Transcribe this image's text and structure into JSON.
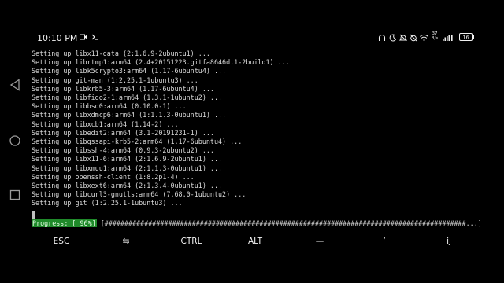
{
  "status_bar": {
    "time": "10:10 PM",
    "left_icons": [
      "video-icon",
      "terminal-prompt-icon"
    ],
    "right_icons": [
      "headphones-icon",
      "do-not-disturb-icon",
      "mute-icon",
      "alarm-off-icon",
      "wifi-icon",
      "network-speed-icon",
      "lte-signal-icon",
      "battery-icon"
    ],
    "network_speed": "37 B/s",
    "battery": "16"
  },
  "nav_bar": {
    "icons": [
      "back-icon",
      "home-icon",
      "recents-icon"
    ]
  },
  "terminal": {
    "lines": [
      "Setting up libx11-data (2:1.6.9-2ubuntu1) ...",
      "Setting up librtmp1:arm64 (2.4+20151223.gitfa8646d.1-2build1) ...",
      "Setting up libk5crypto3:arm64 (1.17-6ubuntu4) ...",
      "Setting up git-man (1:2.25.1-1ubuntu3) ...",
      "Setting up libkrb5-3:arm64 (1.17-6ubuntu4) ...",
      "Setting up libfido2-1:arm64 (1.3.1-1ubuntu2) ...",
      "Setting up libbsd0:arm64 (0.10.0-1) ...",
      "Setting up libxdmcp6:arm64 (1:1.1.3-0ubuntu1) ...",
      "Setting up libxcb1:arm64 (1.14-2) ...",
      "Setting up libedit2:arm64 (3.1-20191231-1) ...",
      "Setting up libgssapi-krb5-2:arm64 (1.17-6ubuntu4) ...",
      "Setting up libssh-4:arm64 (0.9.3-2ubuntu2) ...",
      "Setting up libx11-6:arm64 (2:1.6.9-2ubuntu1) ...",
      "Setting up libxmuu1:arm64 (2:1.1.3-0ubuntu1) ...",
      "Setting up openssh-client (1:8.2p1-4) ...",
      "Setting up libxext6:arm64 (2:1.3.4-0ubuntu1) ...",
      "Setting up libcurl3-gnutls:arm64 (7.68.0-1ubuntu2) ...",
      "Setting up git (1:2.25.1-1ubuntu3) ..."
    ],
    "progress_label": "Progress: [ 96%]",
    "progress_bar": "[###########################################################################################...]",
    "progress_value": 0.96
  },
  "extra_keys": [
    "ESC",
    "⇆",
    "CTRL",
    "ALT",
    "—",
    "’",
    "ij"
  ],
  "colors": {
    "background": "#000000",
    "text": "#d9d9d9",
    "progress_label_bg": "#1f8a2a",
    "nav_icon": "#9a9a9a"
  }
}
